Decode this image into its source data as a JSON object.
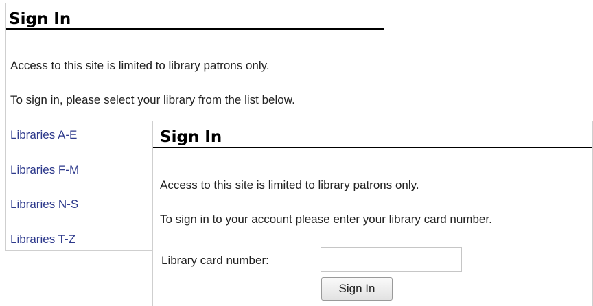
{
  "back_panel": {
    "title": "Sign In",
    "notice": "Access to this site is limited to library patrons only.",
    "instruction": "To sign in, please select your library from the list below.",
    "library_links": [
      {
        "label": "Libraries A-E"
      },
      {
        "label": "Libraries F-M"
      },
      {
        "label": "Libraries N-S"
      },
      {
        "label": "Libraries T-Z"
      }
    ]
  },
  "front_panel": {
    "title": "Sign In",
    "notice": "Access to this site is limited to library patrons only.",
    "instruction": "To sign in to your account please enter your library card number.",
    "card_label": "Library card number:",
    "card_value": "",
    "button_label": "Sign In"
  },
  "colors": {
    "link": "#2e3a8c",
    "title_rule": "#000000",
    "panel_border": "#cfcfcf"
  }
}
